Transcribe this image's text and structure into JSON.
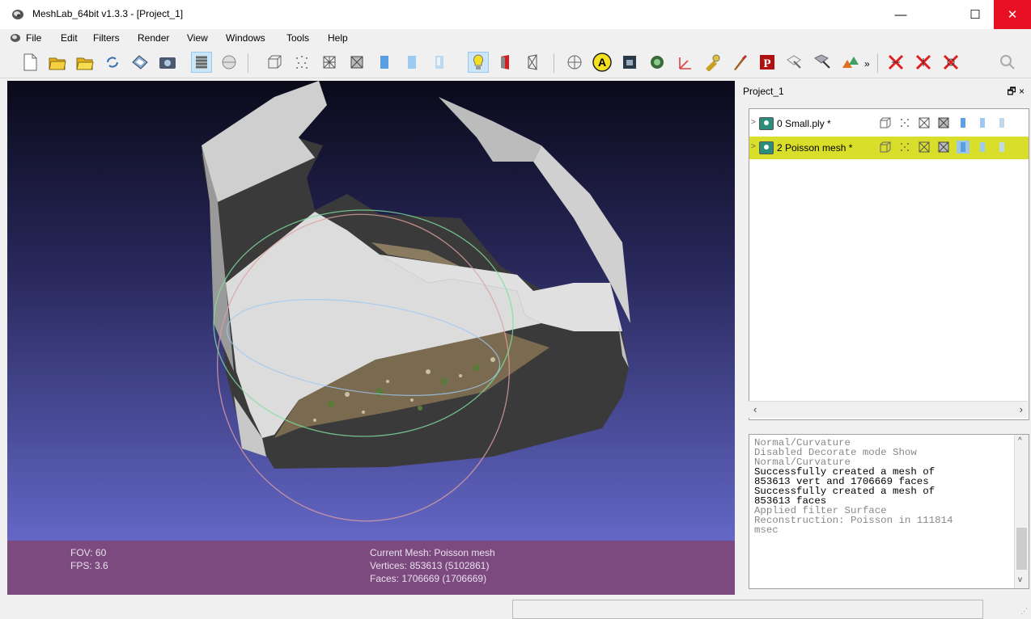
{
  "window": {
    "title": "MeshLab_64bit v1.3.3 - [Project_1]",
    "minimize": "—",
    "maximize": "☐",
    "close": "✕"
  },
  "menu": {
    "items": [
      "File",
      "Edit",
      "Filters",
      "Render",
      "View",
      "Windows",
      "Tools",
      "Help"
    ],
    "mdi_controls": [
      "_",
      "🗗",
      "×"
    ]
  },
  "toolbar": {
    "more_label": "»"
  },
  "viewport": {
    "fov": "FOV: 60",
    "fps": "FPS:   3.6",
    "current_mesh": "Current Mesh: Poisson mesh",
    "vertices": "Vertices: 853613 (5102861)",
    "faces": "Faces: 1706669 (1706669)",
    "background_top": "#0a0a1a",
    "background_bottom": "#7074da",
    "info_bar_color": "#7c4a7e"
  },
  "project_panel": {
    "title": "Project_1",
    "controls": "🗗 ×",
    "layers": [
      {
        "label": "0  Small.ply *",
        "selected": false
      },
      {
        "label": "2  Poisson mesh *",
        "selected": true
      }
    ],
    "selection_color": "#d9de2a"
  },
  "log": {
    "lines": [
      {
        "text": "Normal/Curvature",
        "style": "gray"
      },
      {
        "text": "Disabled Decorate mode Show",
        "style": "gray"
      },
      {
        "text": "Normal/Curvature",
        "style": "gray"
      },
      {
        "text": "Successfully created a mesh of",
        "style": "black"
      },
      {
        "text": "853613 vert and 1706669 faces",
        "style": "black"
      },
      {
        "text": "Successfully created a mesh of",
        "style": "black"
      },
      {
        "text": "853613 faces",
        "style": "black"
      },
      {
        "text": "Applied filter Surface",
        "style": "gray"
      },
      {
        "text": "Reconstruction: Poisson in 111814",
        "style": "gray"
      },
      {
        "text": "msec",
        "style": "gray"
      }
    ]
  }
}
